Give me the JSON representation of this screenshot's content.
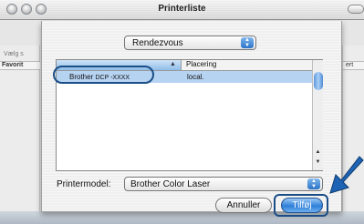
{
  "window": {
    "title": "Printerliste"
  },
  "background": {
    "left_top_text": "Vælg s",
    "left_header": "Favorit",
    "right_header": "ert"
  },
  "sheet": {
    "source_popup": {
      "value": "Rendezvous",
      "arrow_icon": "up-down-arrows-icon"
    },
    "table": {
      "columns": [
        "",
        "Placering"
      ],
      "sort_icon": "sort-up-arrow-icon",
      "rows": [
        {
          "name": "Brother",
          "name_model": "DCP -XXXX",
          "location": "local."
        }
      ]
    },
    "printer_model": {
      "label": "Printermodel:",
      "value": "Brother Color Laser"
    },
    "buttons": {
      "cancel": "Annuller",
      "add": "Tilføj"
    }
  },
  "colors": {
    "selection": "#b6d3f2",
    "accent_blue": "#2e7fd8",
    "callout_outline": "#1b4e86"
  }
}
